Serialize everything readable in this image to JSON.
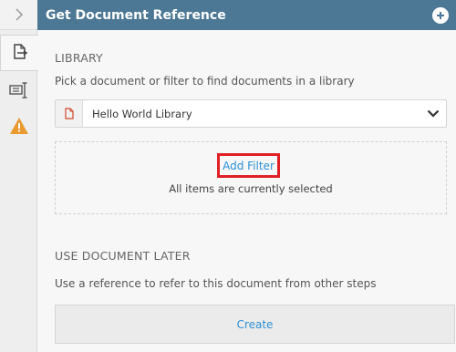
{
  "header": {
    "title": "Get Document Reference",
    "action_icon": "add-circle-icon"
  },
  "rail": {
    "collapse_icon": "chevron-right-icon",
    "tabs": [
      {
        "icon": "document-export-icon",
        "active": true
      },
      {
        "icon": "text-field-icon",
        "active": false
      },
      {
        "icon": "warning-icon",
        "active": false
      }
    ]
  },
  "library": {
    "title": "LIBRARY",
    "description": "Pick a document or filter to find documents in a library",
    "selected": "Hello World Library",
    "add_filter_label": "Add Filter",
    "filter_status": "All items are currently selected"
  },
  "later": {
    "title": "USE DOCUMENT LATER",
    "description": "Use a reference to refer to this document from other steps",
    "create_label": "Create"
  },
  "colors": {
    "header_bg": "#4c7896",
    "link": "#2c8fd6",
    "highlight": "#e01f26",
    "warning": "#e89a2f"
  }
}
